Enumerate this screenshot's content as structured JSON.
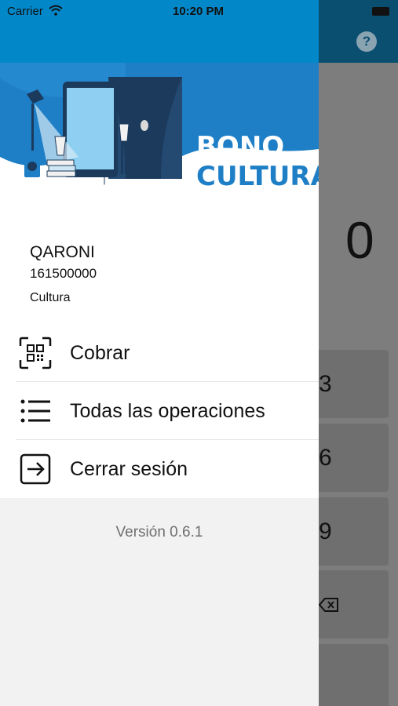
{
  "status_bar": {
    "carrier": "Carrier",
    "time": "10:20 PM"
  },
  "background_app": {
    "help_symbol": "?",
    "amount": "0",
    "keys": [
      "3",
      "6",
      "9"
    ],
    "backspace_icon": "backspace-icon"
  },
  "banner": {
    "line1": "BONO",
    "line2": "CULTURA"
  },
  "user": {
    "name": "QARONI",
    "id": "161500000",
    "category": "Cultura"
  },
  "menu": {
    "items": [
      {
        "label": "Cobrar",
        "icon": "qr-scan-icon"
      },
      {
        "label": "Todas las operaciones",
        "icon": "list-icon"
      },
      {
        "label": "Cerrar sesión",
        "icon": "logout-icon"
      }
    ]
  },
  "version": "Versión 0.6.1",
  "colors": {
    "primary": "#0287c9",
    "banner_blue": "#1e7fc6",
    "dark_accent": "#1b3a5c"
  }
}
